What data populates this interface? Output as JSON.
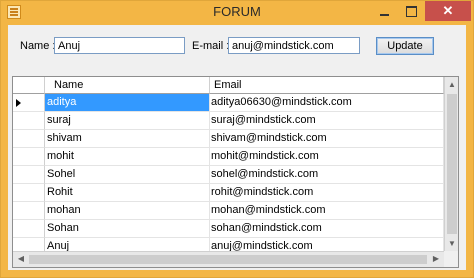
{
  "window": {
    "title": "FORUM",
    "minimize_glyph": "",
    "maximize_glyph": "",
    "close_glyph": "✕"
  },
  "form": {
    "name_label": "Name :",
    "name_value": "Anuj",
    "email_label": "E-mail :",
    "email_value": "anuj@mindstick.com",
    "update_label": "Update"
  },
  "grid": {
    "columns": [
      "Name",
      "Email"
    ],
    "selected_row": 0,
    "rows": [
      {
        "name": "aditya",
        "email": "aditya06630@mindstick.com"
      },
      {
        "name": "suraj",
        "email": "suraj@mindstick.com"
      },
      {
        "name": "shivam",
        "email": "shivam@mindstick.com"
      },
      {
        "name": "mohit",
        "email": "mohit@mindstick.com"
      },
      {
        "name": "Sohel",
        "email": "sohel@mindstick.com"
      },
      {
        "name": "Rohit",
        "email": "rohit@mindstick.com"
      },
      {
        "name": "mohan",
        "email": "mohan@mindstick.com"
      },
      {
        "name": "Sohan",
        "email": "sohan@mindstick.com"
      },
      {
        "name": "Anuj",
        "email": "anuj@mindstick.com"
      }
    ]
  },
  "icons": {
    "app": "form-app-icon",
    "row_indicator": "current-row-arrow-icon",
    "scroll_up": "▲",
    "scroll_down": "▼",
    "scroll_left": "◀",
    "scroll_right": "▶"
  },
  "colors": {
    "titlebar": "#f3b645",
    "close": "#c7504b",
    "selection": "#3399ff"
  }
}
